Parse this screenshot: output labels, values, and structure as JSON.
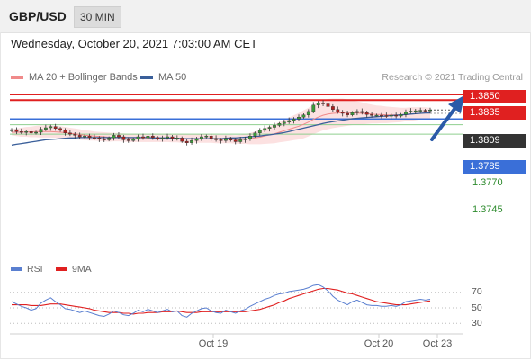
{
  "header": {
    "pair": "GBP/USD",
    "timeframe": "30 MIN"
  },
  "datetime": "Wednesday, October 20, 2021 7:03:00 AM CET",
  "legend": [
    {
      "label": "MA 20 + Bollinger Bands",
      "color": "#f08a8a"
    },
    {
      "label": "MA 50",
      "color": "#3a5f9a"
    }
  ],
  "credit": "Research © 2021 Trading Central",
  "rsi_legend": [
    {
      "label": "RSI",
      "color": "#5a7fd0"
    },
    {
      "label": "9MA",
      "color": "#e02020"
    }
  ],
  "levels": [
    {
      "value": "1.3850",
      "kind": "resistance-box",
      "color": "#e02020"
    },
    {
      "value": "1.3835",
      "kind": "resistance-box",
      "color": "#e02020"
    },
    {
      "value": "1.3809",
      "kind": "current-box",
      "color": "#333333"
    },
    {
      "value": "1.3785",
      "kind": "pivot-box",
      "color": "#3a6fd8"
    },
    {
      "value": "1.3770",
      "kind": "support-text",
      "color": "#2e8b2e"
    },
    {
      "value": "1.3745",
      "kind": "support-text",
      "color": "#2e8b2e"
    }
  ],
  "rsi_ticks": [
    "70",
    "50",
    "30"
  ],
  "x_ticks": [
    "Oct 19",
    "Oct 20",
    "Oct 23"
  ],
  "chart_data": [
    {
      "type": "candlestick",
      "title": "GBP/USD",
      "timeframe": "30 MIN",
      "ylim": [
        1.37,
        1.385
      ],
      "horizontal_levels": [
        1.385,
        1.3835,
        1.3785,
        1.377,
        1.3745
      ],
      "current_price": 1.3809,
      "bias_arrow": "up",
      "close": [
        1.3757,
        1.3752,
        1.375,
        1.3752,
        1.3748,
        1.375,
        1.3758,
        1.3762,
        1.3765,
        1.376,
        1.3755,
        1.3748,
        1.3745,
        1.3742,
        1.3738,
        1.374,
        1.3736,
        1.3735,
        1.3732,
        1.373,
        1.3735,
        1.3742,
        1.3738,
        1.373,
        1.3728,
        1.3732,
        1.3738,
        1.3735,
        1.374,
        1.3736,
        1.3732,
        1.3735,
        1.3738,
        1.3734,
        1.3735,
        1.3726,
        1.3722,
        1.3728,
        1.3733,
        1.3738,
        1.374,
        1.3734,
        1.373,
        1.3728,
        1.3734,
        1.3729,
        1.3725,
        1.373,
        1.3733,
        1.374,
        1.3748,
        1.3755,
        1.376,
        1.3763,
        1.3768,
        1.3773,
        1.3777,
        1.3781,
        1.3785,
        1.379,
        1.3796,
        1.3805,
        1.3822,
        1.3828,
        1.3825,
        1.3818,
        1.381,
        1.3804,
        1.38,
        1.3796,
        1.3802,
        1.3805,
        1.3802,
        1.3797,
        1.3795,
        1.3795,
        1.3794,
        1.3793,
        1.3795,
        1.3793,
        1.3797,
        1.3804,
        1.3806,
        1.3807,
        1.3808,
        1.3807,
        1.3809
      ],
      "ma20": [
        1.375,
        1.375,
        1.375,
        1.3751,
        1.3751,
        1.3752,
        1.3752,
        1.3752,
        1.3752,
        1.3751,
        1.375,
        1.3749,
        1.3747,
        1.3746,
        1.3744,
        1.3742,
        1.3741,
        1.374,
        1.3739,
        1.3738,
        1.3737,
        1.3737,
        1.3737,
        1.3736,
        1.3735,
        1.3735,
        1.3735,
        1.3735,
        1.3735,
        1.3735,
        1.3735,
        1.3735,
        1.3735,
        1.3734,
        1.3734,
        1.3733,
        1.3733,
        1.3733,
        1.3733,
        1.3733,
        1.3733,
        1.3733,
        1.3732,
        1.3732,
        1.3732,
        1.3732,
        1.3731,
        1.3731,
        1.3732,
        1.3733,
        1.3735,
        1.3737,
        1.374,
        1.3743,
        1.3746,
        1.375,
        1.3754,
        1.3758,
        1.3762,
        1.3766,
        1.3771,
        1.3777,
        1.3784,
        1.379,
        1.3795,
        1.3798,
        1.38,
        1.3801,
        1.3802,
        1.3802,
        1.3802,
        1.3801,
        1.38,
        1.3799,
        1.3798,
        1.3797,
        1.3797,
        1.3796,
        1.3796,
        1.3796,
        1.3796,
        1.3797,
        1.3798,
        1.3799,
        1.38,
        1.3801,
        1.3801
      ],
      "ma50": [
        1.3716,
        1.3718,
        1.372,
        1.3722,
        1.3724,
        1.3726,
        1.3728,
        1.373,
        1.3731,
        1.3732,
        1.3733,
        1.3734,
        1.3735,
        1.3735,
        1.3736,
        1.3736,
        1.3736,
        1.3736,
        1.3736,
        1.3736,
        1.3736,
        1.3736,
        1.3736,
        1.3736,
        1.3736,
        1.3736,
        1.3736,
        1.3736,
        1.3736,
        1.3735,
        1.3735,
        1.3735,
        1.3735,
        1.3734,
        1.3734,
        1.3733,
        1.3733,
        1.3733,
        1.3733,
        1.3733,
        1.3733,
        1.3733,
        1.3733,
        1.3733,
        1.3734,
        1.3735,
        1.3735,
        1.3736,
        1.3737,
        1.3738,
        1.3739,
        1.374,
        1.3742,
        1.3743,
        1.3745,
        1.3747,
        1.3749,
        1.3752,
        1.3755,
        1.3758,
        1.3761,
        1.3764,
        1.3767,
        1.377,
        1.3773,
        1.3776,
        1.3778,
        1.378,
        1.3782,
        1.3784,
        1.3786,
        1.3787,
        1.3788,
        1.3789,
        1.379,
        1.3791,
        1.3792,
        1.3793,
        1.3794,
        1.3795,
        1.3796,
        1.3797,
        1.3798,
        1.3799,
        1.38,
        1.3801,
        1.3801
      ],
      "bb_width": [
        0.0008,
        0.001,
        0.0012,
        0.0013,
        0.0014,
        0.0015,
        0.0016,
        0.0016,
        0.0016,
        0.0016,
        0.0016,
        0.0015,
        0.0015,
        0.0014,
        0.0014,
        0.0013,
        0.0013,
        0.0012,
        0.0012,
        0.0012,
        0.0012,
        0.0011,
        0.0011,
        0.0011,
        0.0011,
        0.0011,
        0.0011,
        0.0011,
        0.0011,
        0.0011,
        0.0011,
        0.0011,
        0.0011,
        0.0011,
        0.0011,
        0.0011,
        0.0011,
        0.0011,
        0.0011,
        0.0011,
        0.0011,
        0.0011,
        0.0011,
        0.0011,
        0.0011,
        0.0011,
        0.0011,
        0.0012,
        0.0013,
        0.0015,
        0.0017,
        0.0019,
        0.0021,
        0.0023,
        0.0025,
        0.0027,
        0.0029,
        0.0031,
        0.0033,
        0.0035,
        0.0037,
        0.0038,
        0.0039,
        0.004,
        0.004,
        0.004,
        0.0039,
        0.0038,
        0.0037,
        0.0035,
        0.0033,
        0.0031,
        0.0029,
        0.0027,
        0.0025,
        0.0024,
        0.0023,
        0.0022,
        0.0021,
        0.002,
        0.0019,
        0.0018,
        0.0018,
        0.0017,
        0.0016,
        0.0015,
        0.0014
      ]
    },
    {
      "type": "line",
      "title": "RSI",
      "ylim": [
        20,
        80
      ],
      "reference_levels": [
        70,
        50,
        30
      ],
      "series": [
        {
          "name": "RSI",
          "values": [
            58,
            55,
            52,
            50,
            47,
            49,
            56,
            60,
            63,
            58,
            54,
            49,
            48,
            46,
            44,
            46,
            44,
            42,
            40,
            39,
            42,
            46,
            44,
            41,
            40,
            43,
            47,
            45,
            48,
            46,
            44,
            46,
            48,
            45,
            46,
            40,
            38,
            43,
            46,
            49,
            50,
            46,
            44,
            43,
            47,
            45,
            43,
            46,
            48,
            52,
            55,
            58,
            61,
            63,
            66,
            68,
            69,
            71,
            72,
            73,
            74,
            76,
            79,
            80,
            77,
            72,
            65,
            60,
            57,
            54,
            58,
            60,
            57,
            54,
            53,
            53,
            52,
            52,
            53,
            52,
            54,
            58,
            59,
            60,
            61,
            60,
            61
          ]
        },
        {
          "name": "9MA",
          "values": [
            54,
            54,
            54,
            54,
            53,
            53,
            53,
            54,
            55,
            55,
            55,
            54,
            53,
            52,
            51,
            50,
            49,
            47,
            46,
            45,
            44,
            44,
            44,
            43,
            43,
            42,
            43,
            43,
            44,
            44,
            44,
            45,
            45,
            45,
            46,
            45,
            44,
            44,
            44,
            45,
            45,
            45,
            45,
            45,
            45,
            45,
            45,
            45,
            45,
            46,
            47,
            48,
            50,
            52,
            54,
            57,
            59,
            62,
            64,
            66,
            68,
            70,
            72,
            74,
            75,
            75,
            74,
            73,
            71,
            69,
            68,
            66,
            64,
            62,
            60,
            58,
            57,
            56,
            55,
            54,
            54,
            54,
            55,
            56,
            57,
            58,
            59
          ]
        }
      ]
    }
  ]
}
